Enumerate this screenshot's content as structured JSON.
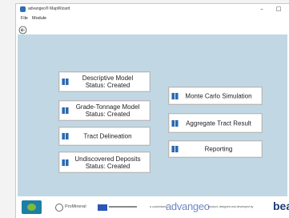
{
  "window": {
    "title": "advangeo® MapWizard",
    "minimize": "–",
    "close": "□"
  },
  "menu": {
    "items": [
      "File",
      "Module"
    ]
  },
  "toolbar": {
    "back_icon": "back-arrow-icon"
  },
  "main": {
    "buttons": [
      {
        "label": "Descriptive Model",
        "status": "Status: Created"
      },
      {
        "label": "Grade-Tonnage Model",
        "status": "Status: Created"
      },
      {
        "label": "Tract Delineation",
        "status": ""
      },
      {
        "label": "Undiscovered Deposits",
        "status": "Status: Created"
      },
      {
        "label": "Monte Carlo Simulation",
        "status": ""
      },
      {
        "label": "Aggregate Tract Result",
        "status": ""
      },
      {
        "label": "Reporting",
        "status": ""
      }
    ]
  },
  "footer": {
    "partner_name": "ProMineral",
    "credit_prefix": "a customized",
    "brand": "advangeo",
    "credit_suffix": "product, designed and developed by",
    "company": "beak"
  },
  "colors": {
    "background": "#c1d8e4",
    "button_border": "#b8b8b8",
    "brand_blue": "#7188c5",
    "company_blue": "#1d3c72"
  }
}
